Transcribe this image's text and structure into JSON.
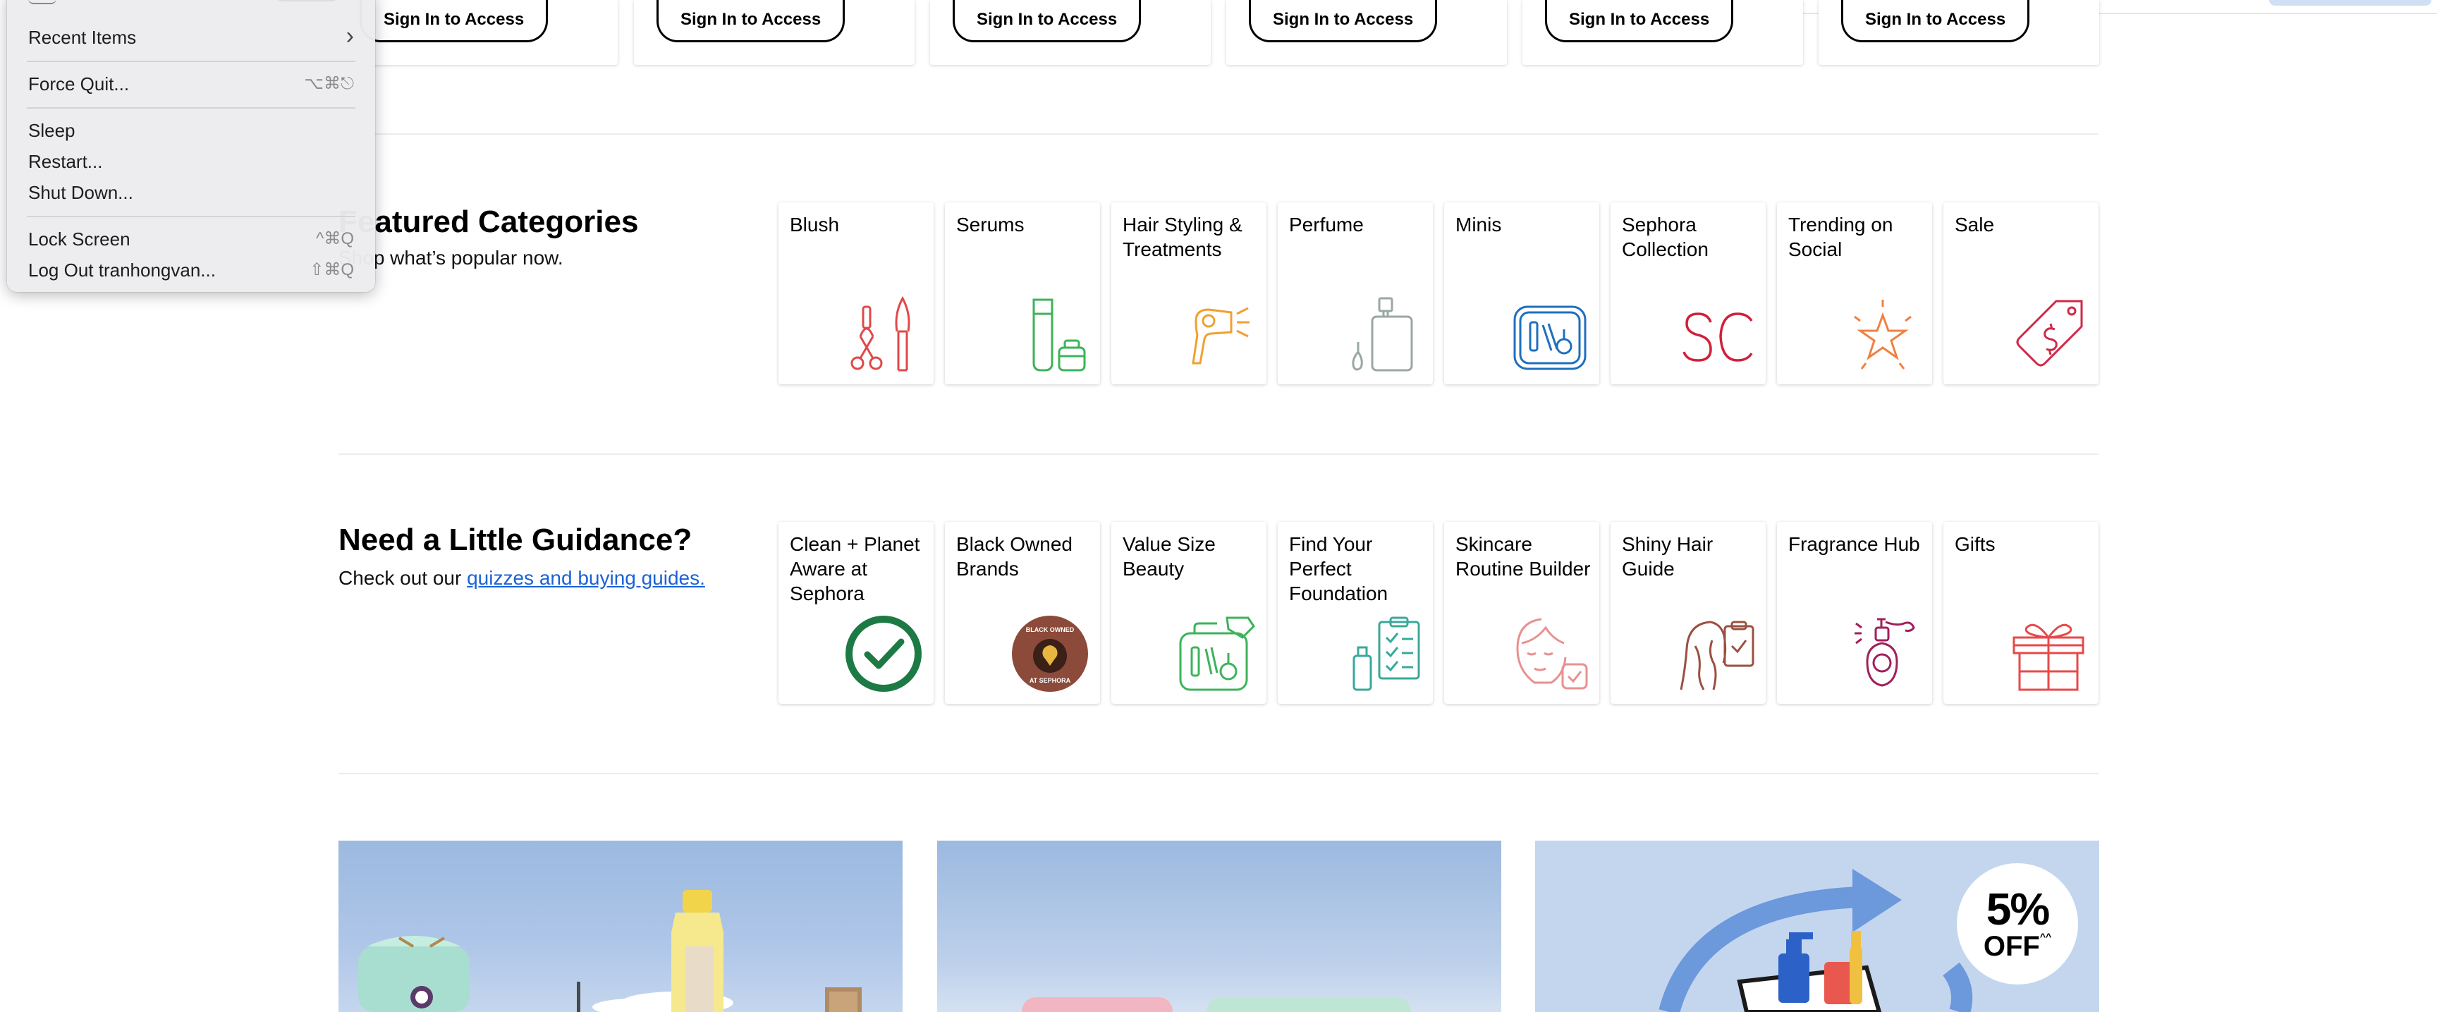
{
  "top_strip": {
    "cards": [
      {
        "button": "Sign In to Access"
      },
      {
        "button": "Sign In to Access"
      },
      {
        "button": "Sign In to Access"
      },
      {
        "button": "Sign In to Access"
      },
      {
        "button": "Sign In to Access"
      },
      {
        "button": "Sign In to Access"
      }
    ]
  },
  "featured": {
    "title": "Featured Categories",
    "subtitle": "Shop what’s popular now.",
    "tiles": [
      {
        "label": "Blush",
        "icon": "makeup-brush-icon",
        "color": "#e04848"
      },
      {
        "label": "Serums",
        "icon": "serum-tube-icon",
        "color": "#3cb35a"
      },
      {
        "label": "Hair Styling & Treatments",
        "icon": "hair-dryer-icon",
        "color": "#f0a030"
      },
      {
        "label": "Perfume",
        "icon": "perfume-bottle-icon",
        "color": "#9aa8a4"
      },
      {
        "label": "Minis",
        "icon": "mini-pouch-icon",
        "color": "#1f6fbd"
      },
      {
        "label": "Sephora Collection",
        "icon": "sephora-collection-icon",
        "color": "#d0203a"
      },
      {
        "label": "Trending on Social",
        "icon": "star-burst-icon",
        "color": "#f08040"
      },
      {
        "label": "Sale",
        "icon": "sale-tag-icon",
        "color": "#d02848"
      }
    ]
  },
  "guidance": {
    "title": "Need a Little Guidance?",
    "subtitle_prefix": "Check out our ",
    "subtitle_link": "quizzes and buying guides.",
    "tiles": [
      {
        "label": "Clean + Planet Aware at Sephora",
        "icon": "clean-check-icon",
        "color": "#1d7a45"
      },
      {
        "label": "Black Owned Brands",
        "icon": "black-owned-badge-icon",
        "color": "#8b4a3a",
        "badge_text": "BLACK OWNED AT SEPHORA"
      },
      {
        "label": "Value Size Beauty",
        "icon": "value-size-kit-icon",
        "color": "#3cb35a"
      },
      {
        "label": "Find Your Perfect Foundation",
        "icon": "foundation-checklist-icon",
        "color": "#3aa89a"
      },
      {
        "label": "Skincare Routine Builder",
        "icon": "skincare-face-icon",
        "color": "#e89090"
      },
      {
        "label": "Shiny Hair Guide",
        "icon": "hair-guide-icon",
        "color": "#9a5040"
      },
      {
        "label": "Fragrance Hub",
        "icon": "fragrance-atomizer-icon",
        "color": "#a0205a"
      },
      {
        "label": "Gifts",
        "icon": "gift-box-icon",
        "color": "#e84848"
      }
    ]
  },
  "promos": {
    "third_badge": {
      "value": "5%",
      "label": "OFF",
      "suffix": "^^"
    }
  },
  "apple_menu": {
    "items": [
      {
        "label": "Recent Items",
        "shortcut": "›"
      },
      {
        "label": "Force Quit...",
        "shortcut": "⌥⌘⎋"
      },
      {
        "label": "Sleep",
        "shortcut": ""
      },
      {
        "label": "Restart...",
        "shortcut": ""
      },
      {
        "label": "Shut Down...",
        "shortcut": ""
      },
      {
        "label": "Lock Screen",
        "shortcut": "^⌘Q"
      },
      {
        "label": "Log Out tranhongvan...",
        "shortcut": "⇧⌘Q"
      }
    ]
  }
}
